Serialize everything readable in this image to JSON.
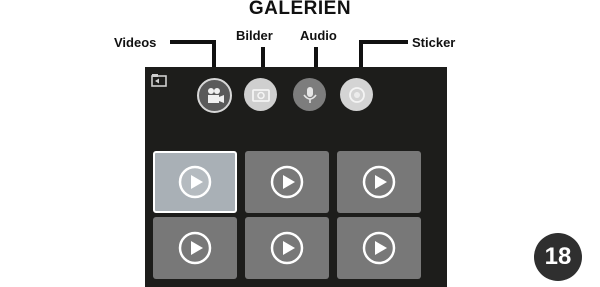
{
  "title": "GALERIEN",
  "callouts": {
    "videos": "Videos",
    "bilder": "Bilder",
    "audio": "Audio",
    "sticker": "Sticker"
  },
  "device_screen": {
    "back_icon": "back-folder-icon",
    "categories": [
      {
        "name": "Videos",
        "icon": "video-camera-icon",
        "selected": true
      },
      {
        "name": "Bilder",
        "icon": "photo-icon",
        "selected": false
      },
      {
        "name": "Audio",
        "icon": "microphone-icon",
        "selected": false
      },
      {
        "name": "Sticker",
        "icon": "sticker-icon",
        "selected": false
      }
    ],
    "thumbnails": [
      {
        "type": "video",
        "selected": true
      },
      {
        "type": "video",
        "selected": false
      },
      {
        "type": "video",
        "selected": false
      },
      {
        "type": "video",
        "selected": false
      },
      {
        "type": "video",
        "selected": false
      },
      {
        "type": "video",
        "selected": false
      }
    ]
  },
  "page_number": "18",
  "colors": {
    "screen_bg": "#1d1d1b",
    "tile": "#787878",
    "tile_selected": "#a9b0b6",
    "badge": "#2f2f2f"
  }
}
